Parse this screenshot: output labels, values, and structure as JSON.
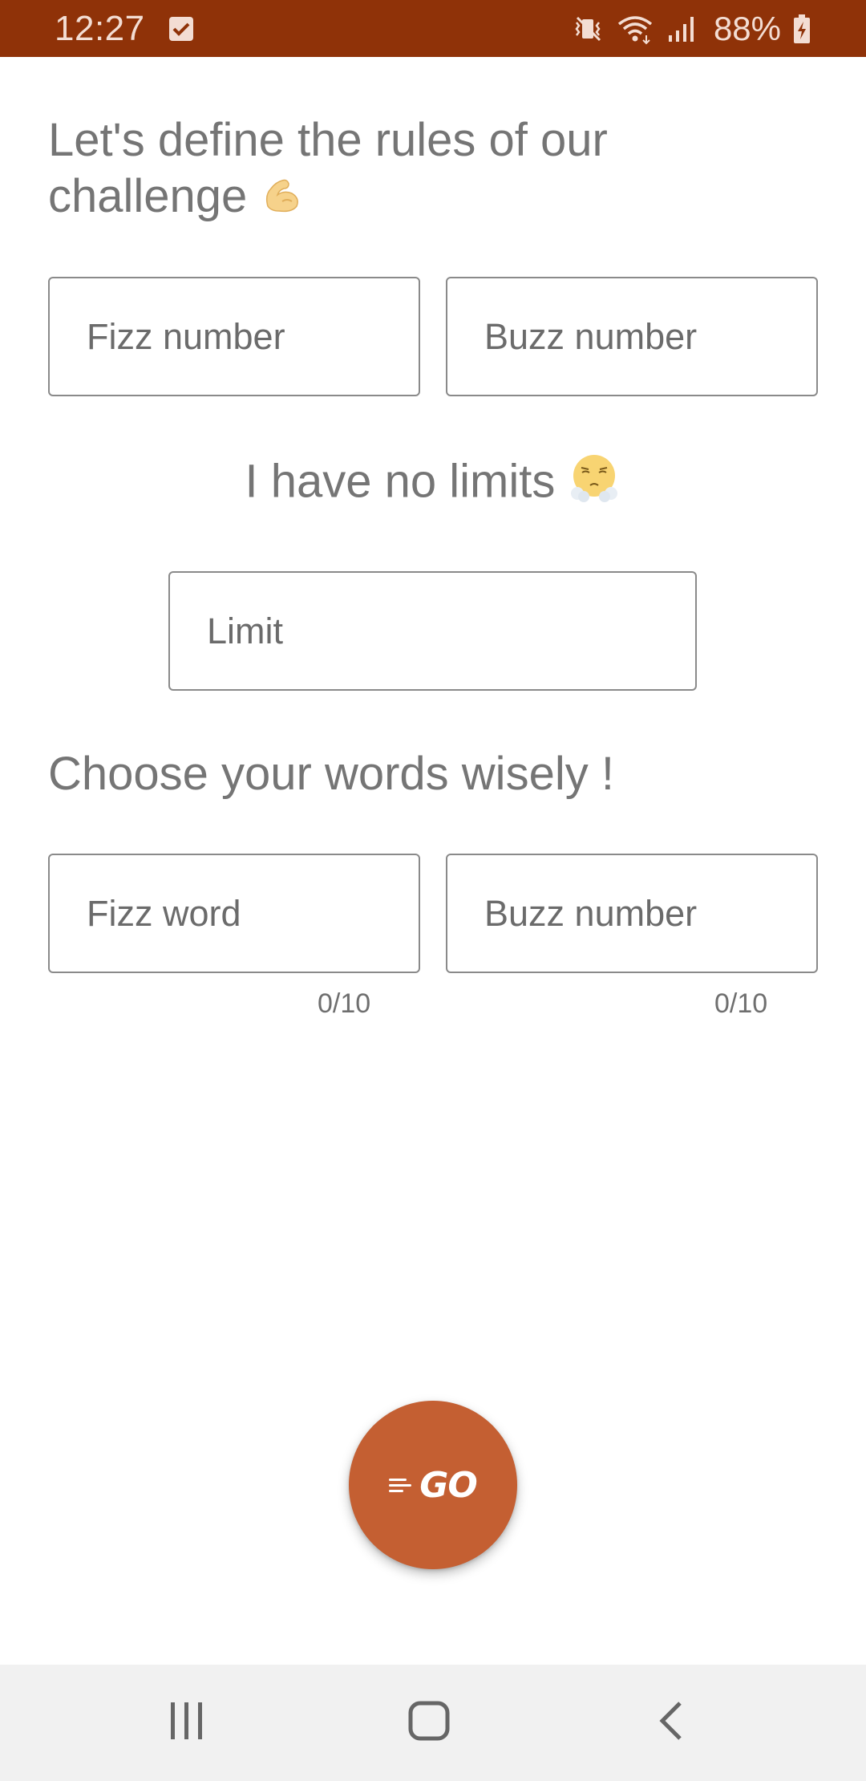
{
  "status_bar": {
    "time": "12:27",
    "battery": "88%",
    "icons": [
      "checkbox-notification-icon",
      "vibrate-mute-icon",
      "wifi-icon",
      "signal-icon",
      "battery-charging-icon"
    ]
  },
  "form": {
    "rules_heading_line1": "Let's define the rules of our",
    "rules_heading_line2": "challenge",
    "fizz_number_placeholder": "Fizz number",
    "buzz_number_placeholder": "Buzz number",
    "limits_heading": "I have no limits",
    "limit_placeholder": "Limit",
    "words_heading": "Choose your words wisely !",
    "fizz_word_placeholder": "Fizz word",
    "buzz_word_placeholder": "Buzz number",
    "fizz_word_counter": "0/10",
    "buzz_word_counter": "0/10"
  },
  "fab": {
    "label": "GO",
    "color": "#c45f32"
  },
  "nav_bar": {
    "items": [
      "recents-icon",
      "home-icon",
      "back-icon"
    ]
  },
  "colors": {
    "status_bar": "#8f3208",
    "text": "#757575",
    "border": "#8a8a8a",
    "nav_bar": "#f1f1f1"
  }
}
